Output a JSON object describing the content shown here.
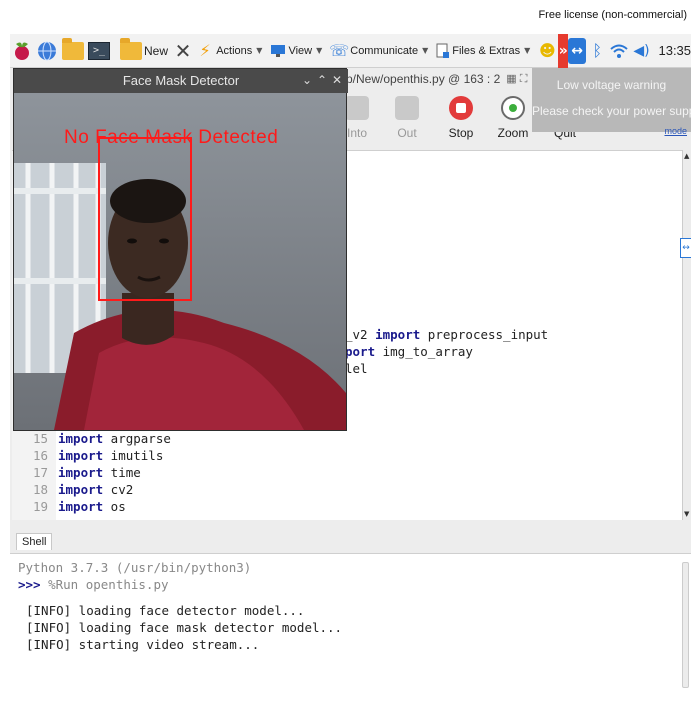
{
  "license": {
    "text": "Free license (non-commercial)"
  },
  "taskbar": {
    "new_label": "New",
    "actions_label": "Actions",
    "view_label": "View",
    "communicate_label": "Communicate",
    "files_label": "Files & Extras",
    "time": "13:35"
  },
  "warning": {
    "title": "Low voltage warning",
    "message": "Please check your power supply",
    "mode_link": "mode"
  },
  "editor": {
    "path_title": "p/New/openthis.py  @  163 : 2",
    "tools": {
      "into": "Into",
      "out": "Out",
      "stop": "Stop",
      "zoom": "Zoom",
      "quit": "Quit"
    },
    "fragments": {
      "line1_prefix": "_v2 ",
      "line1_kw": "import",
      "line1_rest": " preprocess_input",
      "line2_kw": "port",
      "line2_rest": " img_to_array",
      "line3": "lel"
    },
    "code_lines": [
      {
        "num": "15",
        "kw": "import",
        "text": " argparse"
      },
      {
        "num": "16",
        "kw": "import",
        "text": " imutils"
      },
      {
        "num": "17",
        "kw": "import",
        "text": " time"
      },
      {
        "num": "18",
        "kw": "import",
        "text": " cv2"
      },
      {
        "num": "19",
        "kw": "import",
        "text": " os"
      }
    ]
  },
  "shell": {
    "tab_label": "Shell",
    "version_line": "Python 3.7.3 (/usr/bin/python3)",
    "prompt": ">>>",
    "run_command": " %Run openthis.py",
    "output": [
      "[INFO] loading face detector model...",
      "[INFO] loading face mask detector model...",
      "[INFO] starting video stream..."
    ]
  },
  "detector": {
    "window_title": "Face Mask Detector",
    "label": "No Face Mask Detected",
    "label_color": "#ff1a1a"
  }
}
